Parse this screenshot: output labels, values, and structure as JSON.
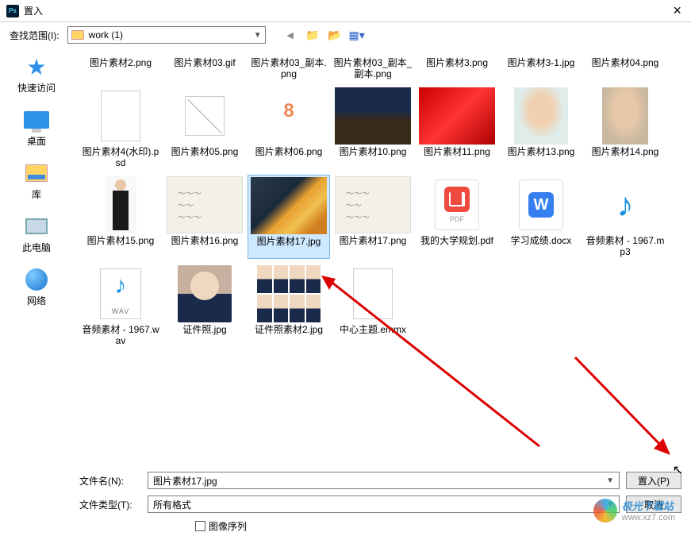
{
  "title": "置入",
  "location_label": "查找范围(I):",
  "location_value": "work (1)",
  "sidebar": [
    {
      "label": "快速访问"
    },
    {
      "label": "桌面"
    },
    {
      "label": "库"
    },
    {
      "label": "此电脑"
    },
    {
      "label": "网络"
    }
  ],
  "files": [
    {
      "name": "图片素材2.png"
    },
    {
      "name": "图片素材03.gif"
    },
    {
      "name": "图片素材03_副本.png"
    },
    {
      "name": "图片素材03_副本_副本.png"
    },
    {
      "name": "图片素材3.png"
    },
    {
      "name": "图片素材3-1.jpg"
    },
    {
      "name": "图片素材04.png"
    },
    {
      "name": "图片素材4(水印).psd"
    },
    {
      "name": "图片素材05.png"
    },
    {
      "name": "图片素材06.png"
    },
    {
      "name": "图片素材10.png"
    },
    {
      "name": "图片素材11.png"
    },
    {
      "name": "图片素材13.png"
    },
    {
      "name": "图片素材14.png"
    },
    {
      "name": "图片素材15.png"
    },
    {
      "name": "图片素材16.png"
    },
    {
      "name": "图片素材17.jpg",
      "selected": true
    },
    {
      "name": "图片素材17.png"
    },
    {
      "name": "我的大学规划.pdf"
    },
    {
      "name": "学习成绩.docx"
    },
    {
      "name": "音频素材 - 1967.mp3"
    },
    {
      "name": "音频素材 - 1967.wav"
    },
    {
      "name": "证件照.jpg"
    },
    {
      "name": "证件照素材2.jpg"
    },
    {
      "name": "中心主题.emmx"
    }
  ],
  "filename_label": "文件名(N):",
  "filename_value": "图片素材17.jpg",
  "filetype_label": "文件类型(T):",
  "filetype_value": "所有格式",
  "place_btn": "置入(P)",
  "cancel_btn": "取消",
  "sequence_label": "图像序列",
  "pdf_text": "PDF",
  "docx_text": "W",
  "wav_text": "WAV",
  "watermark": {
    "line1": "极光下载站",
    "line2": "www.xz7.com"
  }
}
